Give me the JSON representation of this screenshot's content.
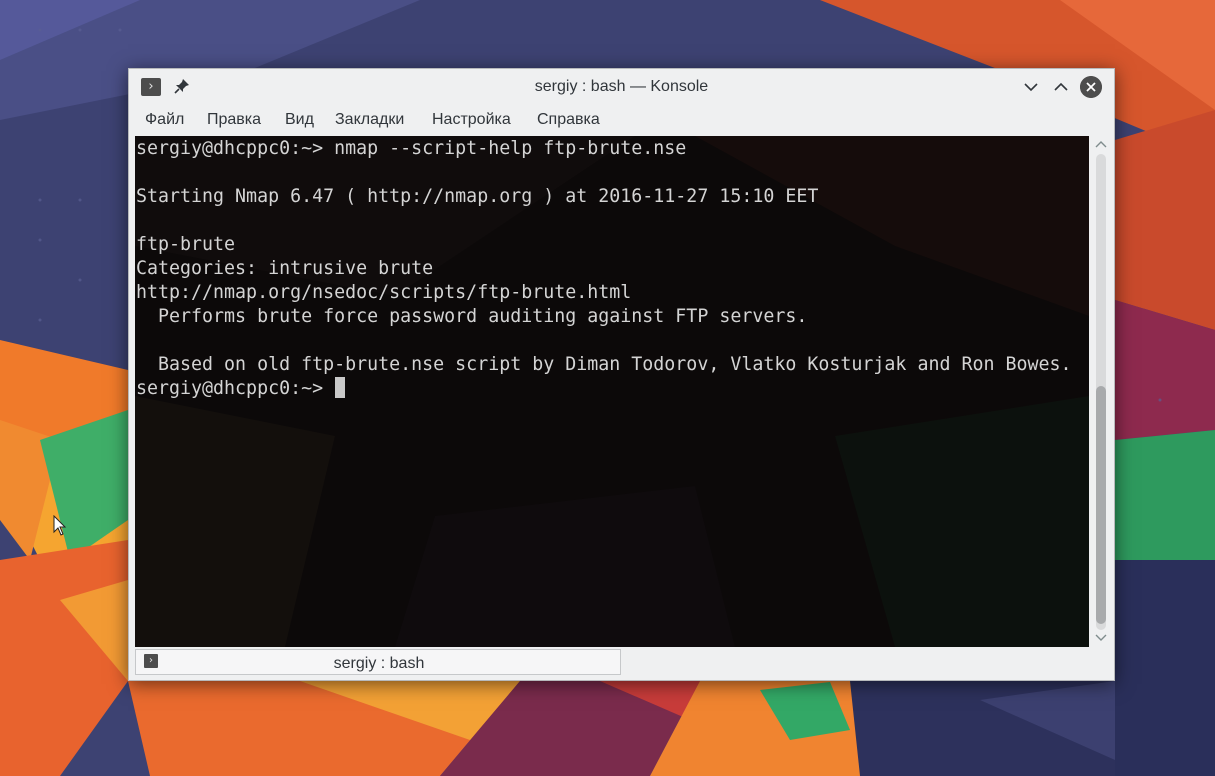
{
  "window": {
    "title": "sergiy : bash — Konsole",
    "app_icon": "terminal-icon",
    "icons": {
      "pin": "pin-icon",
      "minimize": "chevron-down-icon",
      "maximize": "chevron-up-icon",
      "close": "close-icon"
    }
  },
  "menu": {
    "items": [
      "Файл",
      "Правка",
      "Вид",
      "Закладки",
      "Настройка",
      "Справка"
    ]
  },
  "terminal": {
    "lines": [
      "sergiy@dhcppc0:~> nmap --script-help ftp-brute.nse",
      "",
      "Starting Nmap 6.47 ( http://nmap.org ) at 2016-11-27 15:10 EET",
      "",
      "ftp-brute",
      "Categories: intrusive brute",
      "http://nmap.org/nsedoc/scripts/ftp-brute.html",
      "  Performs brute force password auditing against FTP servers.",
      "",
      "  Based on old ftp-brute.nse script by Diman Todorov, Vlatko Kosturjak and Ron Bowes.",
      "sergiy@dhcppc0:~> "
    ]
  },
  "tabs": [
    {
      "label": "sergiy : bash",
      "icon": "terminal-icon"
    }
  ],
  "colors": {
    "terminal_bg": "#0c0909",
    "terminal_fg": "#d4d4d4",
    "chrome_bg": "#eff0f1",
    "chrome_text": "#31363b"
  }
}
